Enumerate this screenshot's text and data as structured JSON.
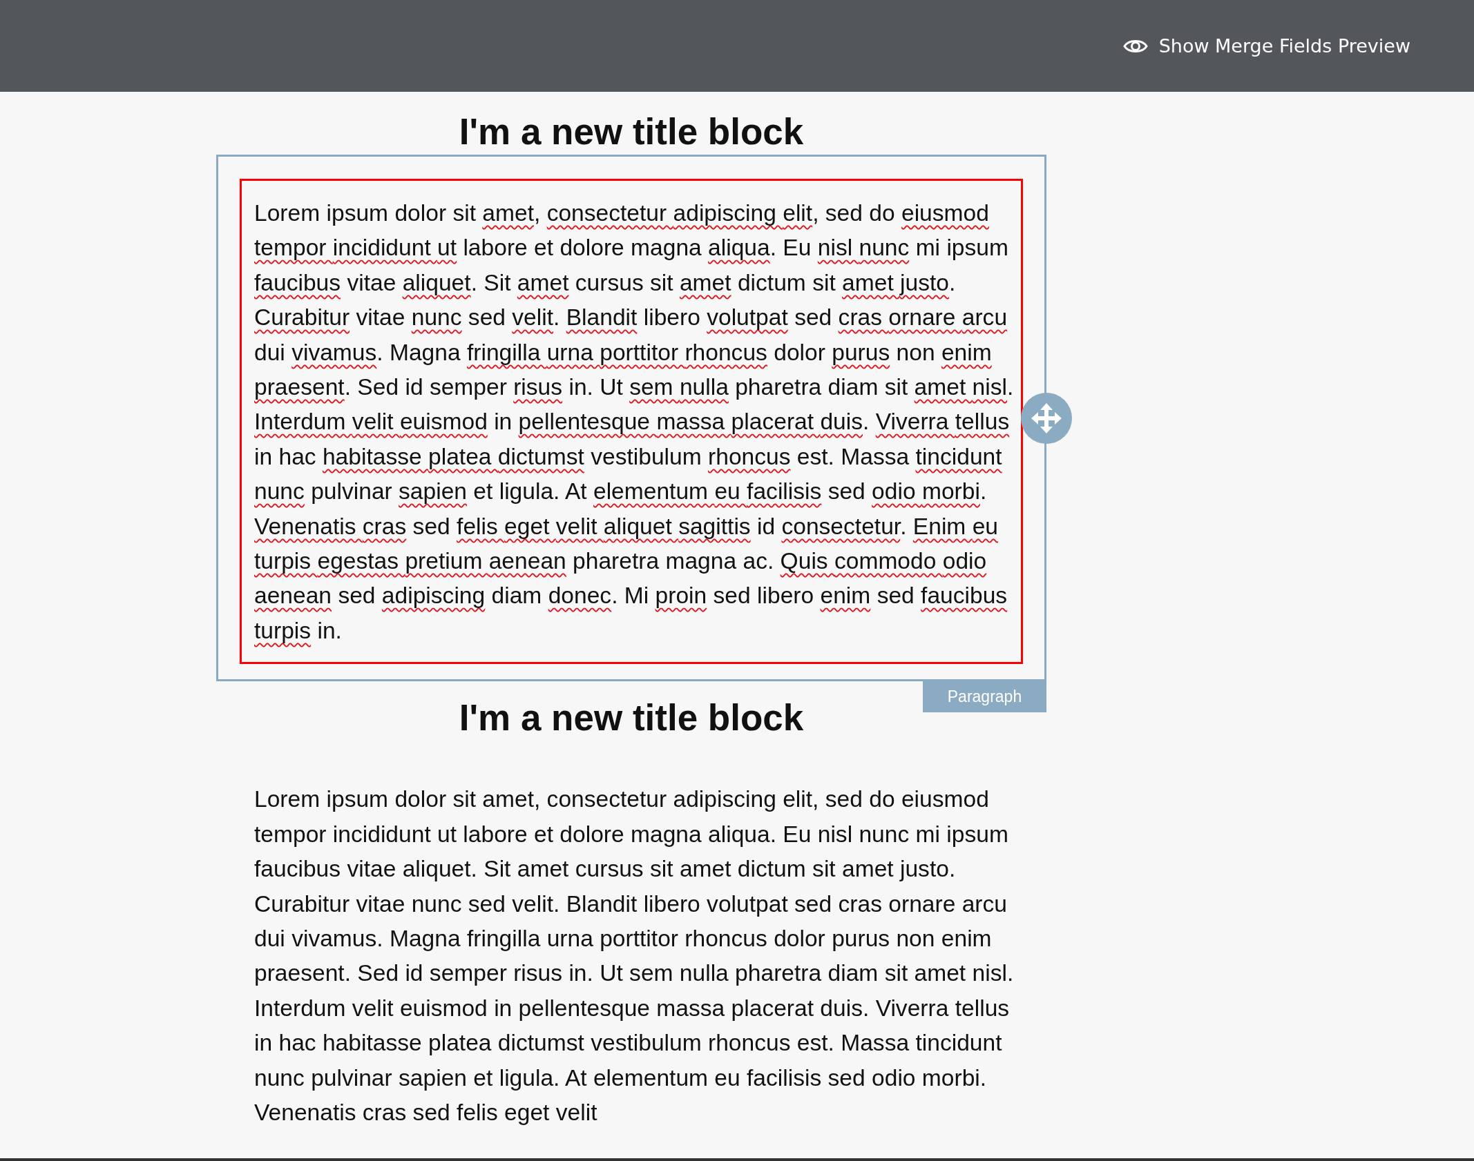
{
  "header": {
    "preview_button": {
      "label": "Show Merge Fields Preview"
    }
  },
  "blocks": [
    {
      "kind": "title",
      "text": "I'm a new title block",
      "selected": false
    },
    {
      "kind": "paragraph",
      "selected": true,
      "tag": "Paragraph",
      "segments": [
        {
          "text": "Lorem ipsum dolor sit ",
          "misspelled": false
        },
        {
          "text": "amet",
          "misspelled": true
        },
        {
          "text": ", ",
          "misspelled": false
        },
        {
          "text": "consectetur ",
          "misspelled": true
        },
        {
          "text": "adipiscing ",
          "misspelled": true
        },
        {
          "text": "elit",
          "misspelled": true
        },
        {
          "text": ", sed do ",
          "misspelled": false
        },
        {
          "text": "eiusmod ",
          "misspelled": true
        },
        {
          "text": "tempor ",
          "misspelled": true
        },
        {
          "text": "incididunt ",
          "misspelled": true
        },
        {
          "text": "ut",
          "misspelled": true
        },
        {
          "text": " labore et dolore magna ",
          "misspelled": false
        },
        {
          "text": "aliqua",
          "misspelled": true
        },
        {
          "text": ". Eu ",
          "misspelled": false
        },
        {
          "text": "nisl ",
          "misspelled": true
        },
        {
          "text": "nunc",
          "misspelled": true
        },
        {
          "text": " mi ipsum ",
          "misspelled": false
        },
        {
          "text": "faucibus",
          "misspelled": true
        },
        {
          "text": " vitae ",
          "misspelled": false
        },
        {
          "text": "aliquet",
          "misspelled": true
        },
        {
          "text": ". Sit ",
          "misspelled": false
        },
        {
          "text": "amet",
          "misspelled": true
        },
        {
          "text": " cursus sit ",
          "misspelled": false
        },
        {
          "text": "amet",
          "misspelled": true
        },
        {
          "text": " dictum sit ",
          "misspelled": false
        },
        {
          "text": "amet ",
          "misspelled": true
        },
        {
          "text": "justo",
          "misspelled": true
        },
        {
          "text": ". ",
          "misspelled": false
        },
        {
          "text": "Curabitur",
          "misspelled": true
        },
        {
          "text": " vitae ",
          "misspelled": false
        },
        {
          "text": "nunc",
          "misspelled": true
        },
        {
          "text": " sed ",
          "misspelled": false
        },
        {
          "text": "velit",
          "misspelled": true
        },
        {
          "text": ". ",
          "misspelled": false
        },
        {
          "text": "Blandit",
          "misspelled": true
        },
        {
          "text": " libero ",
          "misspelled": false
        },
        {
          "text": "volutpat",
          "misspelled": true
        },
        {
          "text": " sed ",
          "misspelled": false
        },
        {
          "text": "cras ",
          "misspelled": true
        },
        {
          "text": "ornare ",
          "misspelled": true
        },
        {
          "text": "arcu",
          "misspelled": true
        },
        {
          "text": " dui ",
          "misspelled": false
        },
        {
          "text": "vivamus",
          "misspelled": true
        },
        {
          "text": ". Magna ",
          "misspelled": false
        },
        {
          "text": "fringilla ",
          "misspelled": true
        },
        {
          "text": "urna ",
          "misspelled": true
        },
        {
          "text": "porttitor ",
          "misspelled": true
        },
        {
          "text": "rhoncus",
          "misspelled": true
        },
        {
          "text": " dolor ",
          "misspelled": false
        },
        {
          "text": "purus",
          "misspelled": true
        },
        {
          "text": " non ",
          "misspelled": false
        },
        {
          "text": "enim ",
          "misspelled": true
        },
        {
          "text": "praesent",
          "misspelled": true
        },
        {
          "text": ". Sed id semper ",
          "misspelled": false
        },
        {
          "text": "risus",
          "misspelled": true
        },
        {
          "text": " in. Ut ",
          "misspelled": false
        },
        {
          "text": "sem ",
          "misspelled": true
        },
        {
          "text": "nulla",
          "misspelled": true
        },
        {
          "text": " pharetra diam sit ",
          "misspelled": false
        },
        {
          "text": "amet ",
          "misspelled": true
        },
        {
          "text": "nisl",
          "misspelled": true
        },
        {
          "text": ". ",
          "misspelled": false
        },
        {
          "text": "Interdum ",
          "misspelled": true
        },
        {
          "text": "velit ",
          "misspelled": true
        },
        {
          "text": "euismod",
          "misspelled": true
        },
        {
          "text": " in ",
          "misspelled": false
        },
        {
          "text": "pellentesque ",
          "misspelled": true
        },
        {
          "text": "massa ",
          "misspelled": true
        },
        {
          "text": "placerat ",
          "misspelled": true
        },
        {
          "text": "duis",
          "misspelled": true
        },
        {
          "text": ". ",
          "misspelled": false
        },
        {
          "text": "Viverra ",
          "misspelled": true
        },
        {
          "text": "tellus",
          "misspelled": true
        },
        {
          "text": " in hac ",
          "misspelled": false
        },
        {
          "text": "habitasse ",
          "misspelled": true
        },
        {
          "text": "platea ",
          "misspelled": true
        },
        {
          "text": "dictumst",
          "misspelled": true
        },
        {
          "text": " vestibulum ",
          "misspelled": false
        },
        {
          "text": "rhoncus",
          "misspelled": true
        },
        {
          "text": " est. Massa ",
          "misspelled": false
        },
        {
          "text": "tincidunt ",
          "misspelled": true
        },
        {
          "text": "nunc",
          "misspelled": true
        },
        {
          "text": " pulvinar ",
          "misspelled": false
        },
        {
          "text": "sapien",
          "misspelled": true
        },
        {
          "text": " et ligula. At ",
          "misspelled": false
        },
        {
          "text": "elementum ",
          "misspelled": true
        },
        {
          "text": "eu ",
          "misspelled": true
        },
        {
          "text": "facilisis",
          "misspelled": true
        },
        {
          "text": " sed ",
          "misspelled": false
        },
        {
          "text": "odio ",
          "misspelled": true
        },
        {
          "text": "morbi",
          "misspelled": true
        },
        {
          "text": ". ",
          "misspelled": false
        },
        {
          "text": "Venenatis ",
          "misspelled": true
        },
        {
          "text": "cras",
          "misspelled": true
        },
        {
          "text": " sed ",
          "misspelled": false
        },
        {
          "text": "felis ",
          "misspelled": true
        },
        {
          "text": "eget ",
          "misspelled": true
        },
        {
          "text": "velit ",
          "misspelled": true
        },
        {
          "text": "aliquet ",
          "misspelled": true
        },
        {
          "text": "sagittis",
          "misspelled": true
        },
        {
          "text": " id ",
          "misspelled": false
        },
        {
          "text": "consectetur",
          "misspelled": true
        },
        {
          "text": ". ",
          "misspelled": false
        },
        {
          "text": "Enim ",
          "misspelled": true
        },
        {
          "text": "eu ",
          "misspelled": true
        },
        {
          "text": "turpis ",
          "misspelled": true
        },
        {
          "text": "egestas ",
          "misspelled": true
        },
        {
          "text": "pretium ",
          "misspelled": true
        },
        {
          "text": "aenean",
          "misspelled": true
        },
        {
          "text": " pharetra magna ac. ",
          "misspelled": false
        },
        {
          "text": "Quis ",
          "misspelled": true
        },
        {
          "text": "commodo ",
          "misspelled": true
        },
        {
          "text": "odio ",
          "misspelled": true
        },
        {
          "text": "aenean",
          "misspelled": true
        },
        {
          "text": " sed ",
          "misspelled": false
        },
        {
          "text": "adipiscing",
          "misspelled": true
        },
        {
          "text": " diam ",
          "misspelled": false
        },
        {
          "text": "donec",
          "misspelled": true
        },
        {
          "text": ". Mi ",
          "misspelled": false
        },
        {
          "text": "proin",
          "misspelled": true
        },
        {
          "text": " sed libero ",
          "misspelled": false
        },
        {
          "text": "enim",
          "misspelled": true
        },
        {
          "text": " sed ",
          "misspelled": false
        },
        {
          "text": "faucibus ",
          "misspelled": true
        },
        {
          "text": "turpis",
          "misspelled": true
        },
        {
          "text": " in.",
          "misspelled": false
        }
      ]
    },
    {
      "kind": "title",
      "text": "I'm a new title block",
      "selected": false
    },
    {
      "kind": "paragraph",
      "selected": false,
      "segments": [
        {
          "text": "Lorem ipsum dolor sit amet, consectetur adipiscing elit, sed do eiusmod tempor incididunt ut labore et dolore magna aliqua. Eu nisl nunc mi ipsum faucibus vitae aliquet. Sit amet cursus sit amet dictum sit amet justo. Curabitur vitae nunc sed velit. Blandit libero volutpat sed cras ornare arcu dui vivamus. Magna fringilla urna porttitor rhoncus dolor purus non enim praesent. Sed id semper risus in. Ut sem nulla pharetra diam sit amet nisl. Interdum velit euismod in pellentesque massa placerat duis. Viverra tellus in hac habitasse platea dictumst vestibulum rhoncus est. Massa tincidunt nunc pulvinar sapien et ligula. At elementum eu facilisis sed odio morbi. Venenatis cras sed felis eget velit",
          "misspelled": false
        }
      ]
    }
  ]
}
